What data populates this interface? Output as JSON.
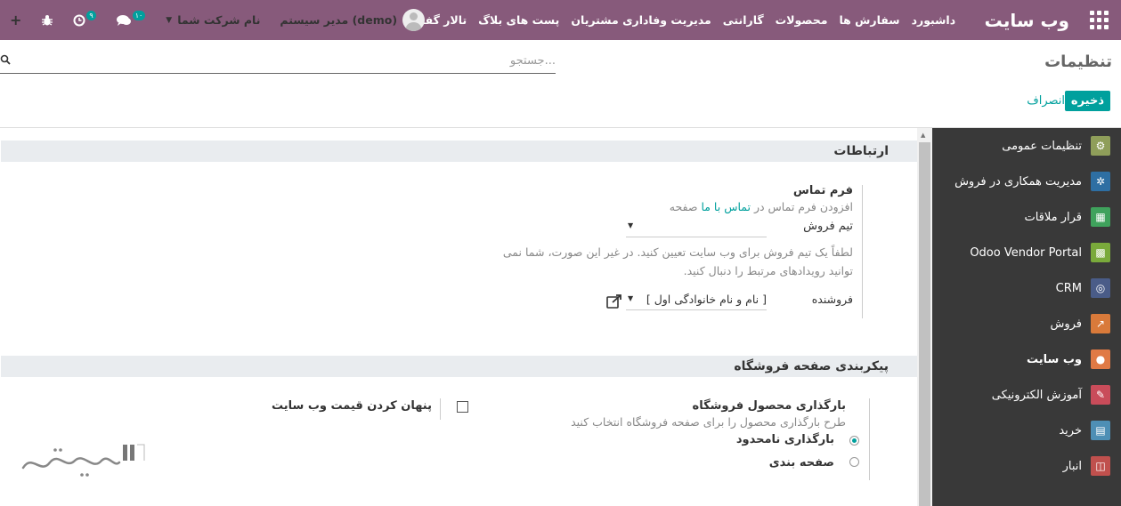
{
  "topbar": {
    "brand": "وب سایت",
    "menu": [
      "داشبورد",
      "سفارش ها",
      "محصولات",
      "گارانتی",
      "مدیریت وفاداری مشتریان",
      "پست های بلاگ",
      "تالار گفتگو"
    ],
    "company": "نام شرکت شما",
    "user": "مدیر سیستم (demo)",
    "activity_badge": "۹",
    "messages_badge": "۱۰",
    "colors": {
      "bar": "#875A7B",
      "badge": "#00A09D"
    }
  },
  "control_panel": {
    "title": "تنظیمات",
    "search_placeholder": "جستجو...",
    "save_label": "ذخیره",
    "cancel_label": "انصراف"
  },
  "sidebar": {
    "items": [
      {
        "label": "تنظیمات عمومی",
        "icon": "gear-icon",
        "color": "#8F9E5A"
      },
      {
        "label": "مدیریت همکاری در فروش",
        "icon": "affiliate-icon",
        "color": "#2E6FA3"
      },
      {
        "label": "قرار ملاقات",
        "icon": "calendar-icon",
        "color": "#3FA25C"
      },
      {
        "label": "Odoo Vendor Portal",
        "icon": "grid-icon",
        "color": "#7AAA3B"
      },
      {
        "label": "CRM",
        "icon": "handshake-icon",
        "color": "#4A5C88"
      },
      {
        "label": "فروش",
        "icon": "chart-icon",
        "color": "#D97A3A"
      },
      {
        "label": "وب سایت",
        "icon": "globe-icon",
        "color": "#E07A45"
      },
      {
        "label": "آموزش الکترونیکی",
        "icon": "elearning-icon",
        "color": "#C94C5A"
      },
      {
        "label": "خرید",
        "icon": "purchase-icon",
        "color": "#4E8FB5"
      },
      {
        "label": "انبار",
        "icon": "box-icon",
        "color": "#C0504D"
      }
    ],
    "active_index": 6
  },
  "communications": {
    "section_title": "ارتباطات",
    "contact_form_title": "فرم تماس",
    "contact_form_desc_pre": "افزودن فرم تماس در",
    "contact_form_link": "تماس با ما",
    "contact_form_desc_post": "صفحه",
    "sales_team_label": "تیم فروش",
    "sales_team_value": "",
    "sales_team_help": "لطفاً یک تیم فروش برای وب سایت تعیین کنید. در غیر این صورت، شما نمی توانید رویدادهای مرتبط را دنبال کنید.",
    "salesperson_label": "فروشنده",
    "salesperson_value": "[ نام و نام خانوادگی اول ]"
  },
  "shop": {
    "section_title": "پیکربندی صفحه فروشگاه",
    "hide_price_label": "پنهان کردن قیمت وب سایت",
    "hide_price_checked": false,
    "loading_title": "بارگذاری محصول فروشگاه",
    "loading_desc": "طرح بارگذاری محصول را برای صفحه فروشگاه انتخاب کنید",
    "options": [
      "بارگذاری نامحدود",
      "صفحه بندی"
    ],
    "selected_option": 0
  }
}
